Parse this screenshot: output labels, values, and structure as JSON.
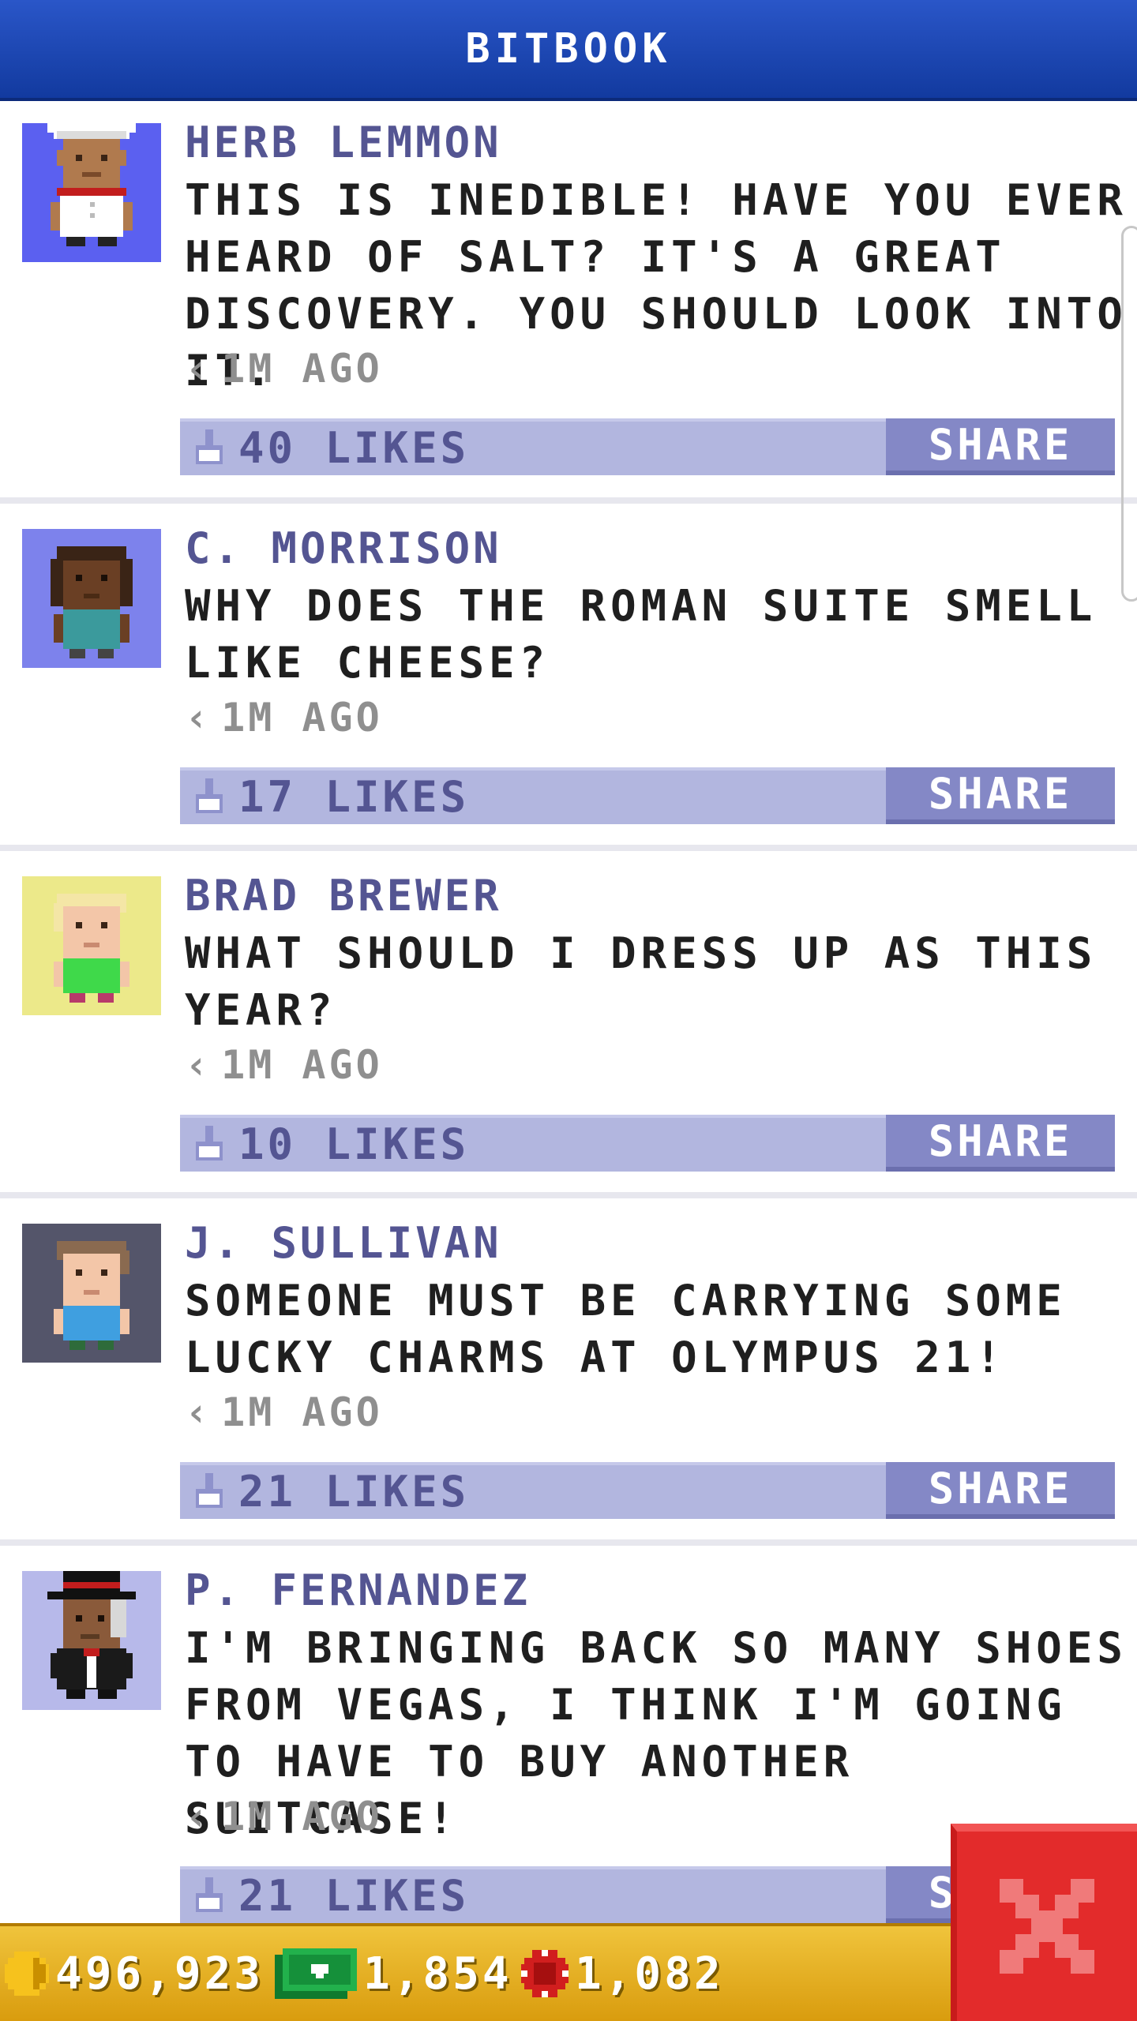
{
  "header": {
    "title": "BITBOOK"
  },
  "posts": [
    {
      "author": "HERB LEMMON",
      "message": "THIS IS INEDIBLE! HAVE YOU EVER HEARD OF SALT? IT'S A GREAT DISCOVERY. YOU SHOULD LOOK INTO IT.",
      "time": "1M AGO",
      "likes": "40 LIKES",
      "share_label": "SHARE",
      "avatar_bg": "#5b60f0",
      "avatar_icon": "chef-avatar-icon"
    },
    {
      "author": "C. MORRISON",
      "message": "WHY DOES THE ROMAN SUITE SMELL LIKE CHEESE?",
      "time": "1M AGO",
      "likes": "17 LIKES",
      "share_label": "SHARE",
      "avatar_bg": "#7d82ec",
      "avatar_icon": "person-avatar-icon"
    },
    {
      "author": "BRAD BREWER",
      "message": "WHAT SHOULD I DRESS UP AS THIS YEAR?",
      "time": "1M AGO",
      "likes": "10 LIKES",
      "share_label": "SHARE",
      "avatar_bg": "#ece98a",
      "avatar_icon": "person-avatar-icon"
    },
    {
      "author": "J. SULLIVAN",
      "message": "SOMEONE MUST BE CARRYING SOME LUCKY CHARMS AT OLYMPUS 21!",
      "time": "1M AGO",
      "likes": "21 LIKES",
      "share_label": "SHARE",
      "avatar_bg": "#54556a",
      "avatar_icon": "person-avatar-icon"
    },
    {
      "author": "P. FERNANDEZ",
      "message": "I'M BRINGING BACK SO MANY SHOES FROM VEGAS, I THINK I'M GOING TO HAVE TO BUY ANOTHER SUITCASE!",
      "time": "1M AGO",
      "likes": "21 LIKES",
      "share_label": "SHARE",
      "avatar_bg": "#b7b9ea",
      "avatar_icon": "top-hat-avatar-icon"
    }
  ],
  "currency": {
    "coins": "496,923",
    "bux": "1,854",
    "chips": "1,082"
  },
  "colors": {
    "header": "#1e4bb8",
    "author": "#545592",
    "likes_bar": "#b2b6df",
    "share_button": "#8488c6",
    "bottom_bar": "#e8b42a",
    "close_button": "#e32b2b"
  },
  "icons": {
    "like": "thumbs-up-icon",
    "coin": "coin-icon",
    "bux": "bux-bill-icon",
    "chip": "casino-chip-icon",
    "close": "close-icon"
  }
}
